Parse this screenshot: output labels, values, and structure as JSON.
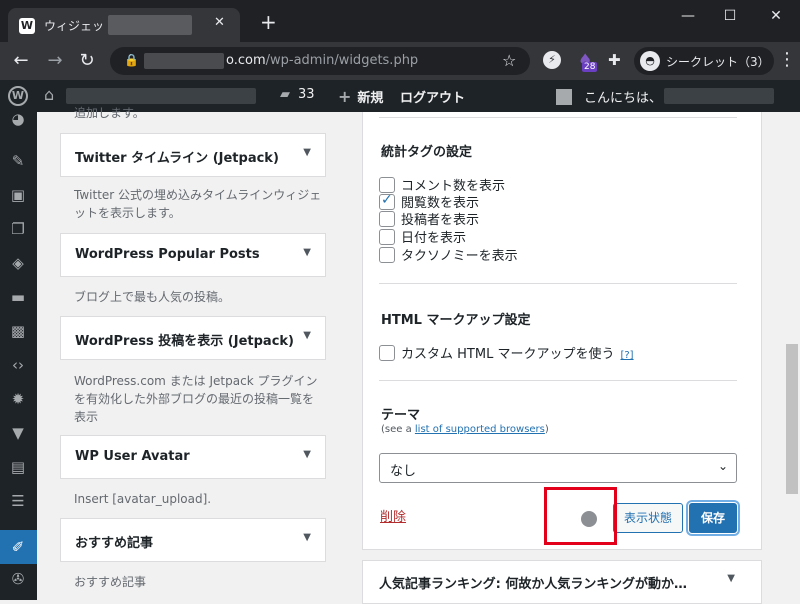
{
  "browser": {
    "tab_title": "ウィジェット ‹",
    "url_domain": "o.com",
    "url_path": "/wp-admin/widgets.php",
    "incognito_label": "シークレット（3）",
    "extension_badge": "28"
  },
  "adminbar": {
    "comment_count": "33",
    "new_label": "新規",
    "logout_label": "ログアウト",
    "howdy_label": "こんにちは、"
  },
  "available_widgets": [
    {
      "title": "Twitter タイムライン (Jetpack)",
      "desc": "Twitter 公式の埋め込みタイムラインウィジェットを表示します。"
    },
    {
      "title": "WordPress Popular Posts",
      "desc": "ブログ上で最も人気の投稿。"
    },
    {
      "title": "WordPress 投稿を表示 (Jetpack)",
      "desc": "WordPress.com または Jetpack プラグインを有効化した外部ブログの最近の投稿一覧を表示"
    },
    {
      "title": "WP User Avatar",
      "desc": "Insert [avatar_upload]."
    },
    {
      "title": "おすすめ記事",
      "desc": "おすすめ記事"
    }
  ],
  "top_partial_desc": "追加します。",
  "panel": {
    "stats_title": "統計タグの設定",
    "stats_options": [
      {
        "label": "コメント数を表示",
        "checked": false
      },
      {
        "label": "閲覧数を表示",
        "checked": true
      },
      {
        "label": "投稿者を表示",
        "checked": false
      },
      {
        "label": "日付を表示",
        "checked": false
      },
      {
        "label": "タクソノミーを表示",
        "checked": false
      }
    ],
    "html_title": "HTML マークアップ設定",
    "html_option": "カスタム HTML マークアップを使う",
    "help_link": "[?]",
    "theme_title": "テーマ",
    "theme_note_prefix": "(see a ",
    "theme_note_link": "list of supported browsers",
    "theme_note_suffix": ")",
    "theme_value": "なし",
    "delete_label": "削除",
    "visibility_label": "表示状態",
    "save_label": "保存"
  },
  "bottom_widget_title": "人気記事ランキング: 何故か人気ランキングが動か…"
}
